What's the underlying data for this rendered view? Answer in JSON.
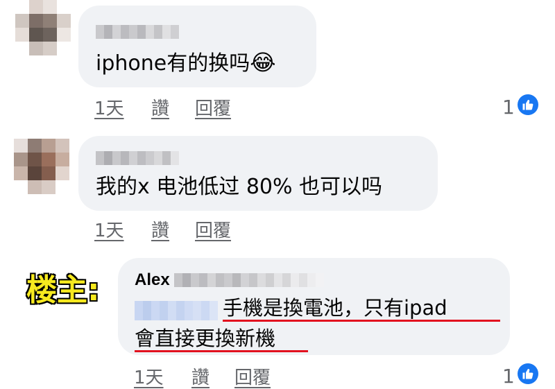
{
  "comments": [
    {
      "text": "iphone有的换吗",
      "emoji": "😂",
      "actions": {
        "time": "1天",
        "like": "讚",
        "reply": "回覆"
      },
      "like_count": "1"
    },
    {
      "text": "我的x 电池低过 80% 也可以吗",
      "actions": {
        "time": "1天",
        "like": "讚",
        "reply": "回覆"
      }
    },
    {
      "owner_tag": "楼主:",
      "author": "Alex",
      "line1": "手機是換電池，只有ipad",
      "line2": "會直接更換新機",
      "actions": {
        "time": "1天",
        "like": "讚",
        "reply": "回覆"
      },
      "like_count": "1"
    }
  ],
  "colors": {
    "like_blue": "#1877f2",
    "bubble": "#f0f2f5",
    "underline_red": "#e2111f",
    "tag_yellow": "#f7ea1f"
  },
  "icons": {
    "like": "thumbs-up-icon"
  }
}
